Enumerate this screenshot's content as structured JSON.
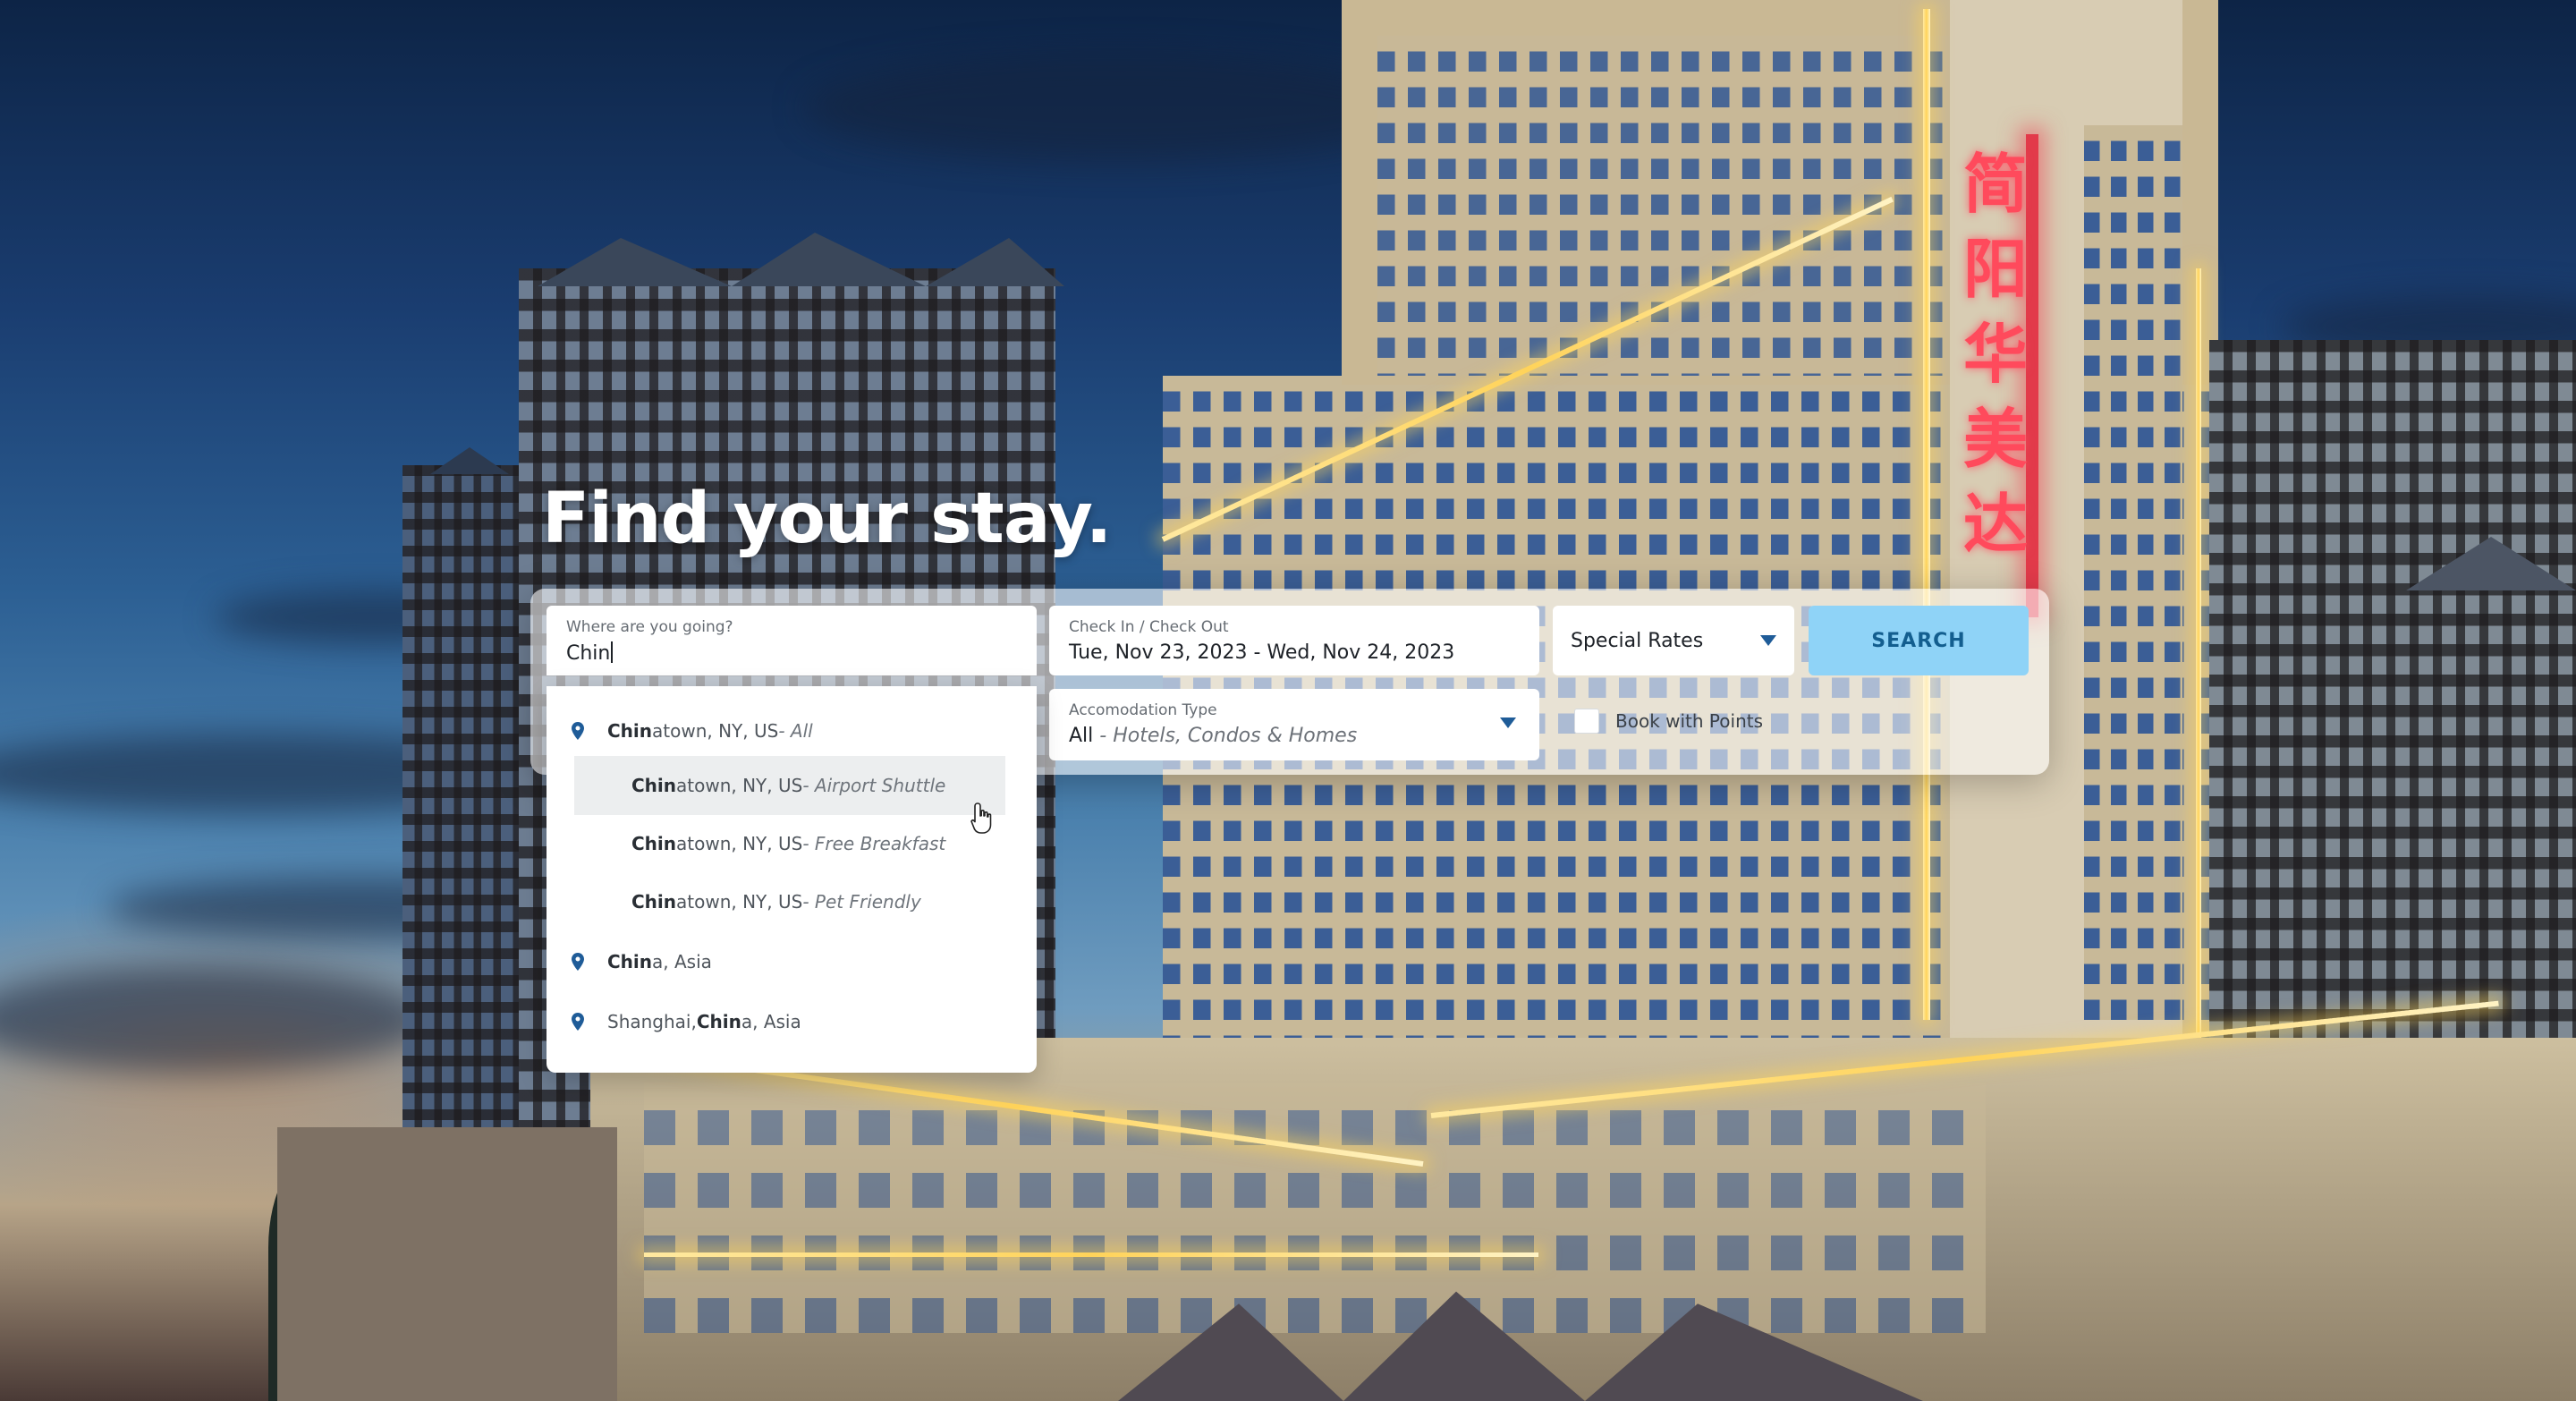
{
  "headline": "Find your stay.",
  "search": {
    "destination_label": "Where are you going?",
    "destination_value": "Chin",
    "dates_label": "Check In / Check Out",
    "dates_value": "Tue, Nov 23, 2023 - Wed, Nov 24, 2023",
    "accommodation_label": "Accomodation Type",
    "accommodation_value": "All",
    "accommodation_rest": " - Hotels, Condos & Homes",
    "special_rates": "Special Rates",
    "search_button": "SEARCH",
    "points_label": "Book with Points"
  },
  "suggestions": [
    {
      "type": "location",
      "match": "Chin",
      "rest": "atown, NY, US",
      "category": " - All"
    },
    {
      "type": "sub",
      "match": "Chin",
      "rest": "atown, NY, US",
      "category": " - Airport Shuttle",
      "hover": true
    },
    {
      "type": "sub",
      "match": "Chin",
      "rest": "atown, NY, US",
      "category": " - Free Breakfast"
    },
    {
      "type": "sub",
      "match": "Chin",
      "rest": "atown, NY, US",
      "category": " - Pet Friendly"
    },
    {
      "type": "location",
      "match": "Chin",
      "rest": "a, Asia",
      "category": ""
    },
    {
      "type": "location",
      "prefix": "Shanghai, ",
      "match": "Chin",
      "rest": "a, Asia",
      "category": ""
    }
  ],
  "colors": {
    "accent": "#1f5c98",
    "search_button_bg": "#8fd3f7",
    "search_button_text": "#135e8f"
  },
  "icons": {
    "location": "location-pin-icon",
    "dropdown": "triangle-down-icon",
    "cursor": "hand-pointer-icon"
  }
}
